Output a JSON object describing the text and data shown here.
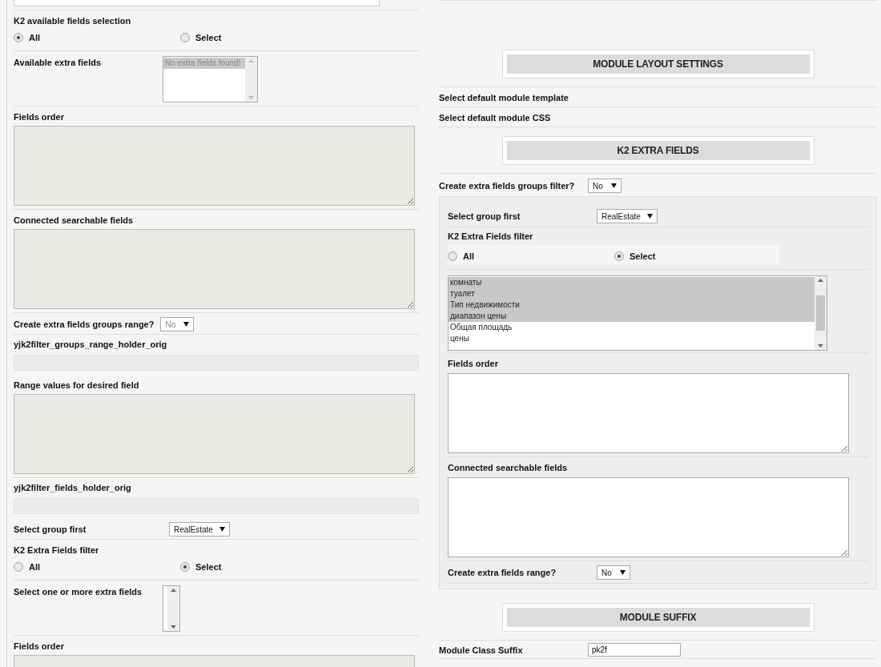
{
  "left": {
    "rows": [
      {
        "kind": "field"
      },
      {
        "kind": "radios",
        "label": "K2 available fields selection",
        "options": [
          {
            "label": "All",
            "selected": true
          },
          {
            "label": "Select",
            "selected": false
          }
        ]
      },
      {
        "kind": "listbox",
        "label": "Available extra fields",
        "disabled": true,
        "options": [
          {
            "label": "No extra fields found!",
            "selected": true
          }
        ]
      },
      {
        "kind": "textarea",
        "label": "Fields order",
        "disabled": true
      },
      {
        "kind": "textarea",
        "label": "Connected searchable fields",
        "disabled": true
      },
      {
        "kind": "select",
        "label": "Create extra fields groups range?",
        "value": "No",
        "disabled": true
      },
      {
        "kind": "bar",
        "label": "yjk2filter_groups_range_holder_orig"
      },
      {
        "kind": "textarea",
        "label": "Range values for desired field",
        "disabled": true
      },
      {
        "kind": "bar",
        "label": "yjk2filter_fields_holder_orig"
      },
      {
        "kind": "select",
        "label": "Select group first",
        "value": "RealEstate",
        "disabled": false
      },
      {
        "kind": "radios",
        "label": "K2 Extra Fields filter",
        "options": [
          {
            "label": "All",
            "selected": false
          },
          {
            "label": "Select",
            "selected": true
          }
        ]
      },
      {
        "kind": "listbox",
        "label": "Select one or more extra fields",
        "disabled": false,
        "options": []
      },
      {
        "kind": "textarea",
        "label": "Fields order",
        "disabled": true
      }
    ]
  },
  "right": {
    "rows": [
      {
        "kind": "header",
        "label": "MODULE LAYOUT SETTINGS"
      },
      {
        "kind": "text",
        "label": "Select default module template"
      },
      {
        "kind": "text",
        "label": "Select default module CSS"
      },
      {
        "kind": "header",
        "label": "K2 EXTRA FIELDS"
      },
      {
        "kind": "select",
        "label": "Create extra fields groups filter?",
        "value": "No",
        "disabled": false
      },
      {
        "kind": "panel",
        "rows": [
          {
            "kind": "select",
            "label": "Select group first",
            "value": "RealEstate",
            "disabled": false
          },
          {
            "kind": "radios",
            "label": "K2 Extra Fields filter",
            "options": [
              {
                "label": "All",
                "selected": false
              },
              {
                "label": "Select",
                "selected": true
              }
            ]
          },
          {
            "kind": "listbox",
            "disabled": false,
            "options": [
              {
                "label": "комнаты",
                "selected": true
              },
              {
                "label": "туалет",
                "selected": true
              },
              {
                "label": "Тип недвижимости",
                "selected": true
              },
              {
                "label": "диапазон цены",
                "selected": true
              },
              {
                "label": "Общая площадь",
                "selected": false
              },
              {
                "label": "цены",
                "selected": false
              }
            ]
          },
          {
            "kind": "textarea",
            "label": "Fields order",
            "disabled": false
          },
          {
            "kind": "textarea",
            "label": "Connected searchable fields",
            "disabled": false
          },
          {
            "kind": "select",
            "label": "Create extra fields range?",
            "value": "No",
            "disabled": false
          }
        ]
      },
      {
        "kind": "header",
        "label": "MODULE SUFFIX"
      },
      {
        "kind": "input",
        "label": "Module Class Suffix",
        "value": "pk2f"
      }
    ]
  }
}
